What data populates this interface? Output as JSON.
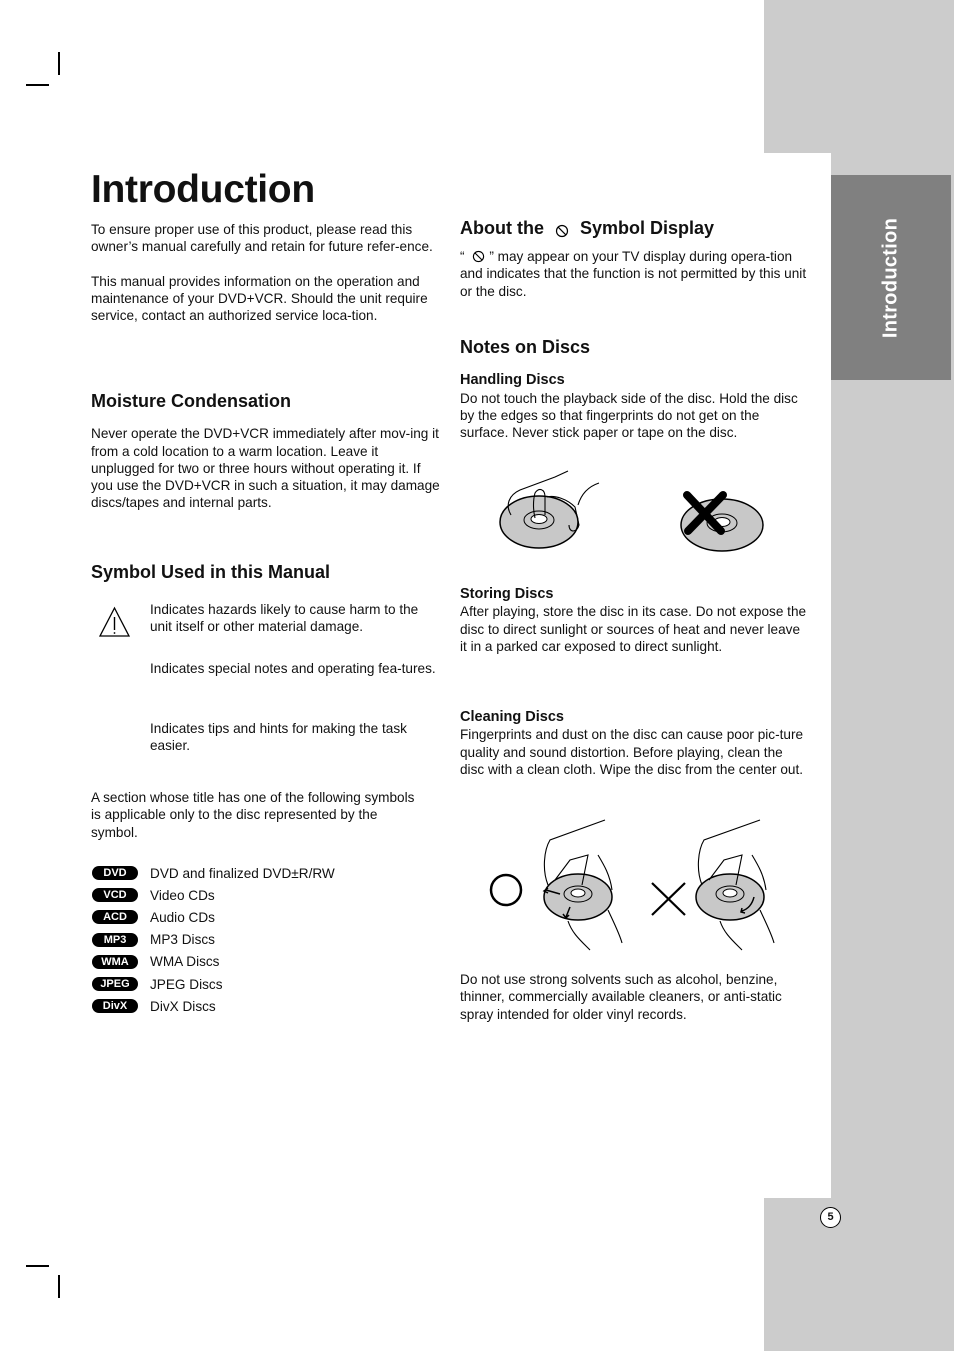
{
  "side_tab": {
    "label": "Introduction"
  },
  "page_number": "5",
  "title": "Introduction",
  "intro": {
    "p1": "To ensure proper use of this product, please read this owner’s manual carefully and retain for future refer-ence.",
    "p2": "This manual provides information on the operation and maintenance of your DVD+VCR. Should the unit require service, contact an authorized service loca-tion."
  },
  "moisture": {
    "heading": "Moisture Condensation",
    "body": "Never operate the DVD+VCR immediately after mov-ing it from a cold location to a warm location. Leave it unplugged for two or three hours without operating it. If you use the DVD+VCR in such a situation, it may damage discs/tapes and internal parts."
  },
  "symbols": {
    "heading": "Symbol Used in this Manual",
    "items": [
      {
        "icon": "warning-triangle-icon",
        "text": "Indicates hazards likely to cause harm to the unit itself or other material damage."
      },
      {
        "icon": "note-icon",
        "text": "Indicates special notes and operating fea-tures."
      },
      {
        "icon": "tip-icon",
        "text": "Indicates tips and hints for making the task easier."
      }
    ],
    "section_note": "A section whose title has one of the following symbols is applicable only to the disc represented by the symbol.",
    "discs": [
      {
        "badge": "DVD",
        "desc": "DVD and finalized DVD±R/RW"
      },
      {
        "badge": "VCD",
        "desc": "Video CDs"
      },
      {
        "badge": "ACD",
        "desc": "Audio CDs"
      },
      {
        "badge": "MP3",
        "desc": "MP3 Discs"
      },
      {
        "badge": "WMA",
        "desc": "WMA Discs"
      },
      {
        "badge": "JPEG",
        "desc": "JPEG Discs"
      },
      {
        "badge": "DivX",
        "desc": "DivX Discs"
      }
    ]
  },
  "about_symbol": {
    "heading_before": "About the",
    "heading_after": "Symbol Display",
    "quote_open": "“",
    "body_after_icon": "” may appear on your TV display during opera-tion and indicates that the function is not permitted by this unit or the disc."
  },
  "notes_on_discs": {
    "heading": "Notes on Discs",
    "handling": {
      "heading": "Handling Discs",
      "body": "Do not touch the playback side of the disc. Hold the disc by the edges so that fingerprints do not get on the surface. Never stick paper or tape on the disc."
    },
    "storing": {
      "heading": "Storing Discs",
      "body": "After playing, store the disc in its case. Do not expose the disc to direct sunlight or sources of heat and never leave it in a parked car exposed to direct sunlight."
    },
    "cleaning": {
      "heading": "Cleaning Discs",
      "body": "Fingerprints and dust on the disc can cause poor pic-ture quality and sound distortion. Before playing, clean the disc with a clean cloth. Wipe the disc from the center out.",
      "warning": "Do not use strong solvents such as alcohol, benzine, thinner, commercially available cleaners, or anti-static spray intended for older vinyl records."
    }
  }
}
